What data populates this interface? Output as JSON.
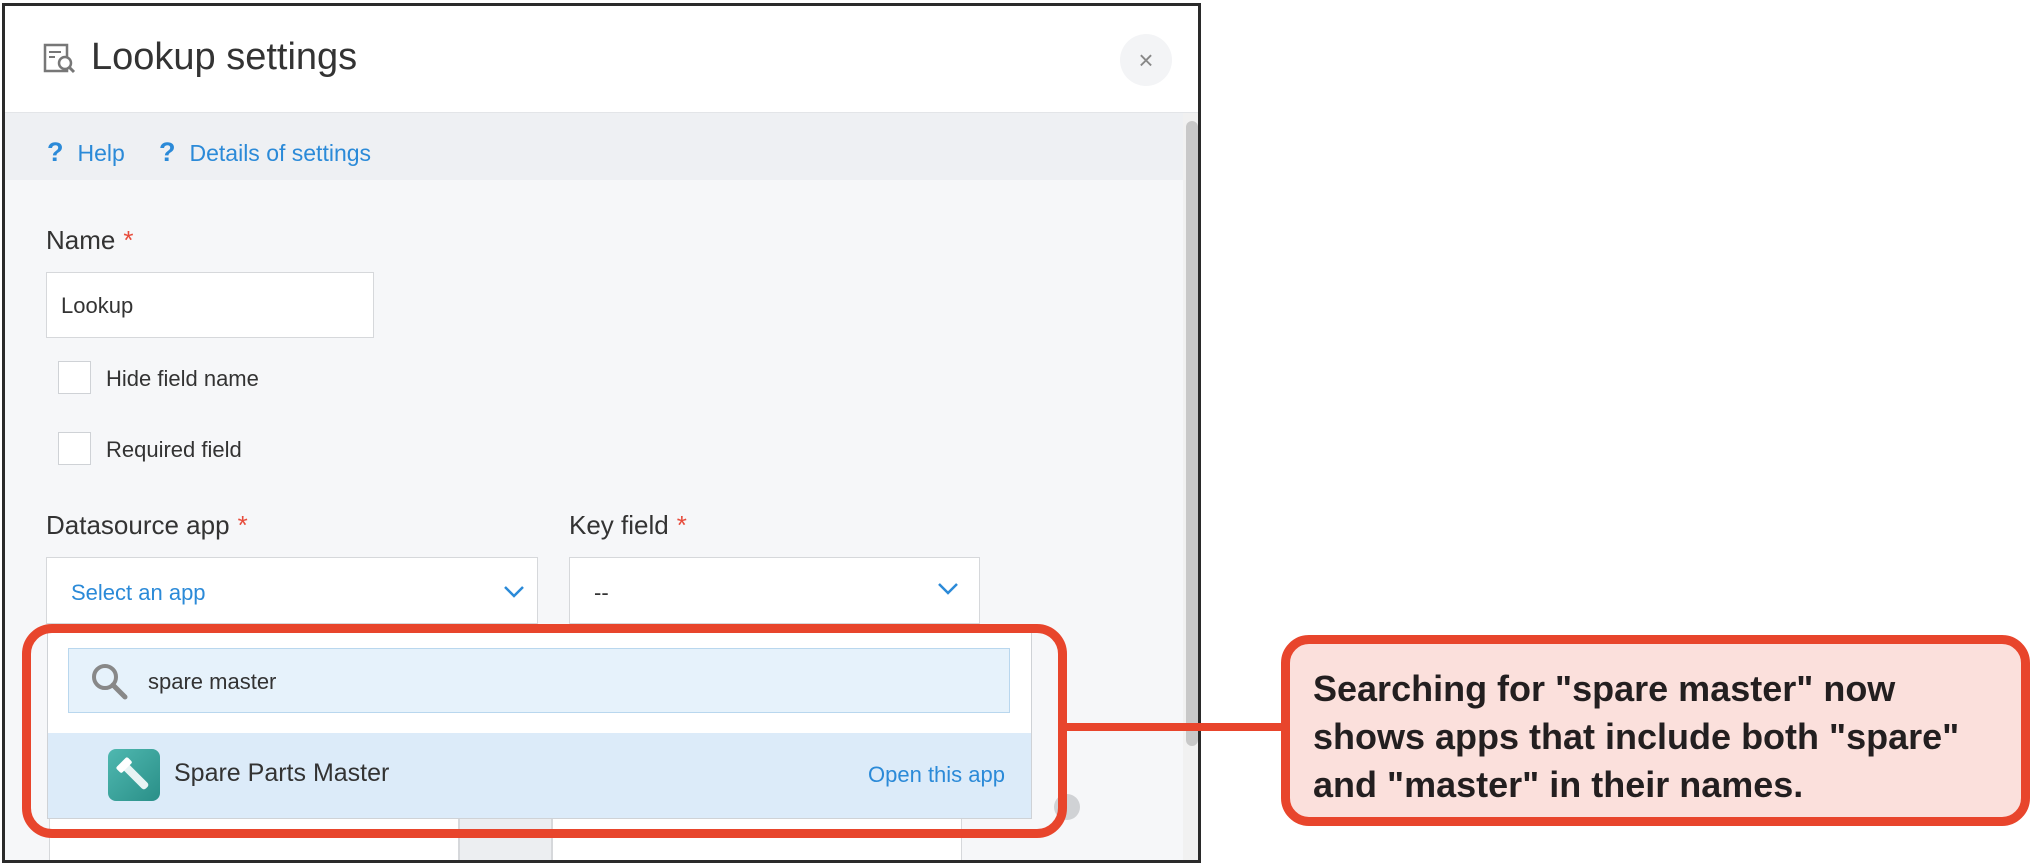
{
  "dialog": {
    "title": "Lookup settings",
    "close_label": "×",
    "help_links": [
      {
        "icon": "?",
        "label": "Help"
      },
      {
        "icon": "?",
        "label": "Details of settings"
      }
    ]
  },
  "form": {
    "name_label": "Name",
    "required_mark": "*",
    "name_value": "Lookup",
    "hide_field_name_label": "Hide field name",
    "hide_field_name_checked": false,
    "required_field_label": "Required field",
    "required_field_checked": false,
    "datasource_label": "Datasource app",
    "datasource_value": "Select an app",
    "key_field_label": "Key field",
    "key_field_value": "--"
  },
  "dropdown": {
    "search_value": "spare master",
    "results": [
      {
        "name": "Spare Parts Master",
        "action": "Open this app",
        "icon": "wrench-app-icon"
      }
    ]
  },
  "callout": {
    "text": "Searching for \"spare master\" now shows apps that include both \"spare\" and \"master\" in their names."
  },
  "colors": {
    "accent": "#2b8ad8",
    "required": "#e74c3c",
    "highlight": "#e8452c",
    "callout_bg": "#fbe0dc"
  }
}
